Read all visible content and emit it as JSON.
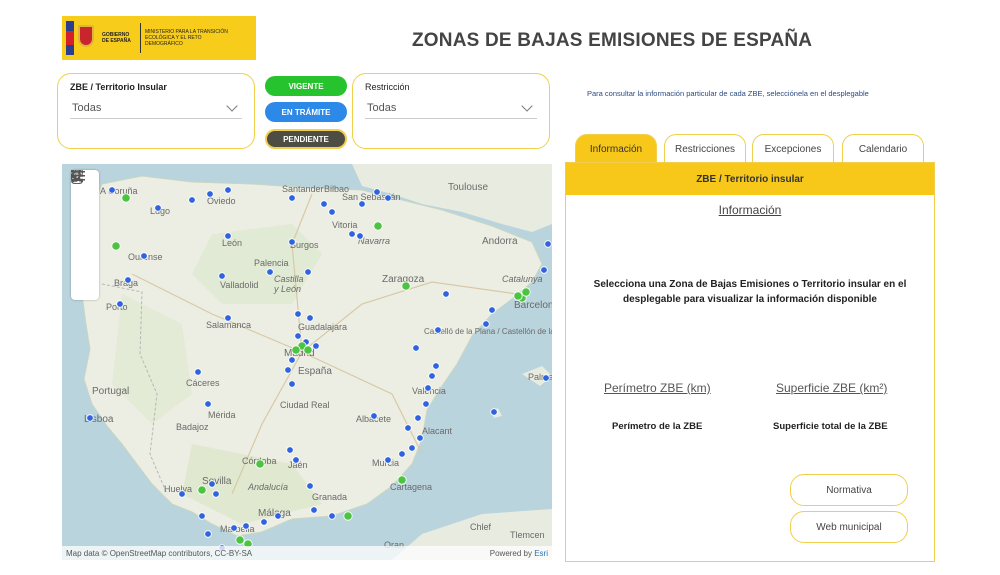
{
  "header": {
    "logo": {
      "gob": "GOBIERNO DE ESPAÑA",
      "ministry": "MINISTERIO PARA LA TRANSICIÓN ECOLÓGICA Y EL RETO DEMOGRÁFICO"
    },
    "title": "ZONAS DE BAJAS EMISIONES DE  ESPAÑA"
  },
  "filters": {
    "zbe": {
      "label": "ZBE / Territorio Insular",
      "value": "Todas"
    },
    "restriccion": {
      "label": "Restricción",
      "value": "Todas"
    }
  },
  "status": {
    "vigente": "VIGENTE",
    "tramite": "EN TRÁMITE",
    "pendiente": "PENDIENTE"
  },
  "hint": "Para consultar la información particular de cada ZBE, selecciónela en el desplegable",
  "tabs": [
    "Información",
    "Restricciones",
    "Excepciones",
    "Calendario"
  ],
  "panel": {
    "header": "ZBE / Territorio insular",
    "info_link": "Información",
    "message": "Selecciona una Zona de Bajas Emisiones o Territorio insular en el desplegable para visualizar la información disponible",
    "perimetro_label": "Perímetro ZBE (km)",
    "superficie_label": "Superficie ZBE (km²)",
    "perimetro_value": "Perímetro de la ZBE",
    "superficie_value": "Superficie total de la ZBE",
    "normativa": "Normativa",
    "web": "Web municipal"
  },
  "map": {
    "attribution": "Map data © OpenStreetMap contributors, CC-BY-SA",
    "powered": "Powered by ",
    "esri": "Esri",
    "labels": {
      "acoruna": "A Coruña",
      "santander": "Santander",
      "bilbao": "Bilbao",
      "sansebastian": "San Sebastián",
      "toulouse": "Toulouse",
      "lugo": "Lugo",
      "oviedo": "Oviedo",
      "leon": "León",
      "burgos": "Burgos",
      "vitoria": "Vitoria",
      "navarra": "Navarra",
      "andorra": "Andorra",
      "ourense": "Ourense",
      "palencia": "Palencia",
      "castilla": "Castilla",
      "yleon": "y León",
      "zaragoza": "Zaragoza",
      "braga": "Braga",
      "valladolid": "Valladolid",
      "porto": "Porto",
      "salamanca": "Salamanca",
      "guadalajara": "Guadalajara",
      "madrid": "Madrid",
      "castellon": "Castelló de la Plana / Castellón de la Plana",
      "espana": "España",
      "portugal": "Portugal",
      "caceres": "Cáceres",
      "ciudadreal": "Ciudad Real",
      "valencia": "València",
      "palma": "Palma",
      "lisboa": "Lisboa",
      "merida": "Mérida",
      "badajoz": "Badajoz",
      "albacete": "Albacete",
      "alicante": "Alacant",
      "cordoba": "Córdoba",
      "jaen": "Jaén",
      "murcia": "Murcia",
      "huelva": "Huelva",
      "sevilla": "Sevilla",
      "andalucia": "Andalucía",
      "granada": "Granada",
      "cartagena": "Cartagena",
      "malaga": "Málaga",
      "marbella": "Marbella",
      "chlef": "Chlef",
      "tlemcen": "Tlemcen",
      "oran": "Oran",
      "barcelona": "Barcelona",
      "catalunya": "Catalunya"
    }
  },
  "colors": {
    "accent": "#f7c81a",
    "vigente": "#27c32f",
    "tramite": "#2d89e8",
    "pendiente": "#4d4d43"
  }
}
